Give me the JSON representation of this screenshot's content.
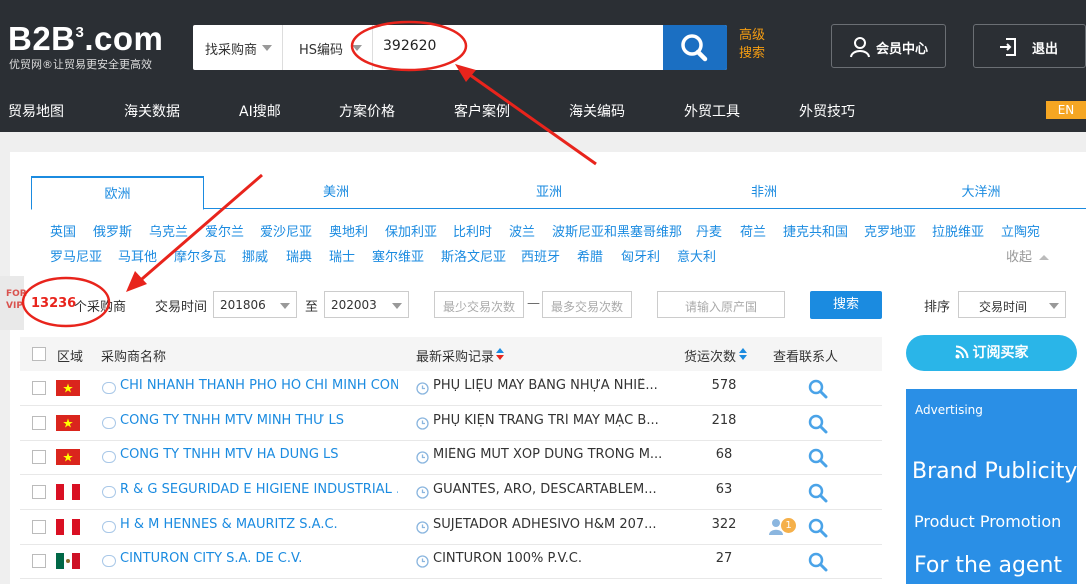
{
  "header": {
    "logo": "B2B³.com",
    "logo_main": "B2B",
    "logo_sup": "3",
    "logo_tld": ".com",
    "tagline": "优贸网®让贸易更安全更高效",
    "search": {
      "type_select": "找采购商",
      "field_select": "HS编码",
      "query": "392620"
    },
    "advanced": "高级搜索",
    "member_center": "会员中心",
    "logout": "退出",
    "nav": [
      "贸易地图",
      "海关数据",
      "AI搜邮",
      "方案价格",
      "客户案例",
      "海关编码",
      "外贸工具",
      "外贸技巧"
    ],
    "lang": "EN"
  },
  "regions": {
    "tabs": [
      "欧洲",
      "美洲",
      "亚洲",
      "非洲",
      "大洋洲"
    ],
    "active": "欧洲",
    "countries_row1": [
      "英国",
      "俄罗斯",
      "乌克兰",
      "爱尔兰",
      "爱沙尼亚",
      "奥地利",
      "保加利亚",
      "比利时",
      "波兰",
      "波斯尼亚和黑塞哥维那",
      "丹麦",
      "荷兰",
      "捷克共和国",
      "克罗地亚",
      "拉脱维亚",
      "立陶宛"
    ],
    "countries_row2": [
      "罗马尼亚",
      "马耳他",
      "摩尔多瓦",
      "挪威",
      "瑞典",
      "瑞士",
      "塞尔维亚",
      "斯洛文尼亚",
      "西班牙",
      "希腊",
      "匈牙利",
      "意大利"
    ],
    "collapse": "收起"
  },
  "vip_tab": "FOR VIP",
  "filters": {
    "count": "13236",
    "count_suffix": "个采购商",
    "trade_time_label": "交易时间",
    "from": "201806",
    "to_label": "至",
    "to": "202003",
    "min_placeholder": "最少交易次数",
    "dash": "—",
    "max_placeholder": "最多交易次数",
    "origin_placeholder": "请输入原产国",
    "search_btn": "搜索",
    "sort_label": "排序",
    "sort_value": "交易时间"
  },
  "table": {
    "headers": [
      "区域",
      "采购商名称",
      "最新采购记录",
      "货运次数",
      "查看联系人"
    ],
    "rows": [
      {
        "flag": "vn",
        "name": "CHI NHÁNH THÀNH PHỐ HỒ CHÍ MINH CÔN...",
        "record": "PHỤ LIỆU MAY BẰNG NHỰA NHIỀ...",
        "count": "578",
        "badge": ""
      },
      {
        "flag": "vn",
        "name": "CÔNG TY TNHH MTV MINH THƯ LS",
        "record": "PHỤ KIỆN TRANG TRÍ MAY MẶC B...",
        "count": "218",
        "badge": ""
      },
      {
        "flag": "vn",
        "name": "CÔNG TY TNHH MTV HÀ DŨNG LS",
        "record": "MIẾNG MÚT XỐP DÙNG TRONG M...",
        "count": "68",
        "badge": ""
      },
      {
        "flag": "pe",
        "name": "R & G SEGURIDAD E HIGIENE INDUSTRIAL ...",
        "record": "GUANTES, ARO, DESCARTABLEM...",
        "count": "63",
        "badge": ""
      },
      {
        "flag": "pe",
        "name": "H & M HENNES & MAURITZ S.A.C.",
        "record": "SUJETADOR ADHESIVO H&M 207...",
        "count": "322",
        "badge": "1"
      },
      {
        "flag": "mx",
        "name": "CINTURON CITY S.A. DE C.V.",
        "record": "CINTURON 100% P.V.C.",
        "count": "27",
        "badge": ""
      }
    ]
  },
  "sidebar": {
    "subscribe": "订阅买家",
    "ad_label": "Advertising",
    "ad_lines": [
      "Brand Publicity",
      "Product Promotion",
      "For the agent"
    ]
  },
  "colors": {
    "header_bg": "#2b2f34",
    "accent": "#1b8be0",
    "orange": "#f39c12",
    "annotation": "#e8241c"
  }
}
